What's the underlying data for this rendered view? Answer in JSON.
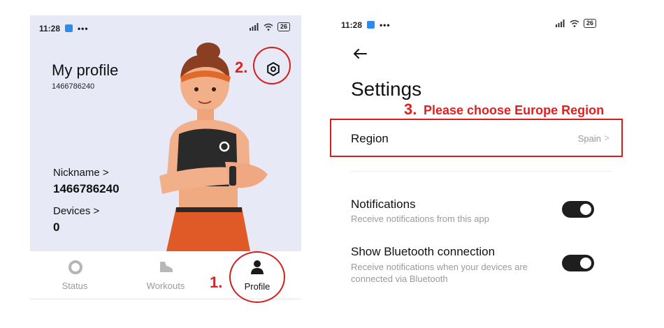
{
  "left": {
    "status": {
      "time": "11:28",
      "dots": "•••",
      "battery": "26"
    },
    "profile": {
      "title": "My profile",
      "id": "1466786240",
      "nickname_label": "Nickname >",
      "nickname_value": "1466786240",
      "devices_label": "Devices >",
      "devices_value": "0"
    },
    "tabs": [
      {
        "label": "Status",
        "icon": "status-ring-icon",
        "active": false
      },
      {
        "label": "Workouts",
        "icon": "shoe-icon",
        "active": false
      },
      {
        "label": "Profile",
        "icon": "person-icon",
        "active": true
      }
    ]
  },
  "right": {
    "status": {
      "time": "11:28",
      "dots": "•••",
      "battery": "26"
    },
    "back_icon": "back-arrow-icon",
    "title": "Settings",
    "region": {
      "label": "Region",
      "value": "Spain",
      "chevron": ">"
    },
    "notifications": {
      "title": "Notifications",
      "subtitle": "Receive notifications from this app",
      "enabled": true
    },
    "bluetooth": {
      "title": "Show Bluetooth connection",
      "subtitle_line1": "Receive notifications when your devices are",
      "subtitle_line2": "connected via Bluetooth",
      "enabled": true
    }
  },
  "annotations": {
    "step1": "1.",
    "step2": "2.",
    "step3": "3.",
    "step3_text": "Please choose Europe Region"
  },
  "colors": {
    "annotation_red": "#e02020",
    "profile_bg": "#e7e9f7",
    "toggle_on": "#1e1e1e",
    "app_badge": "#2a8cf0"
  }
}
